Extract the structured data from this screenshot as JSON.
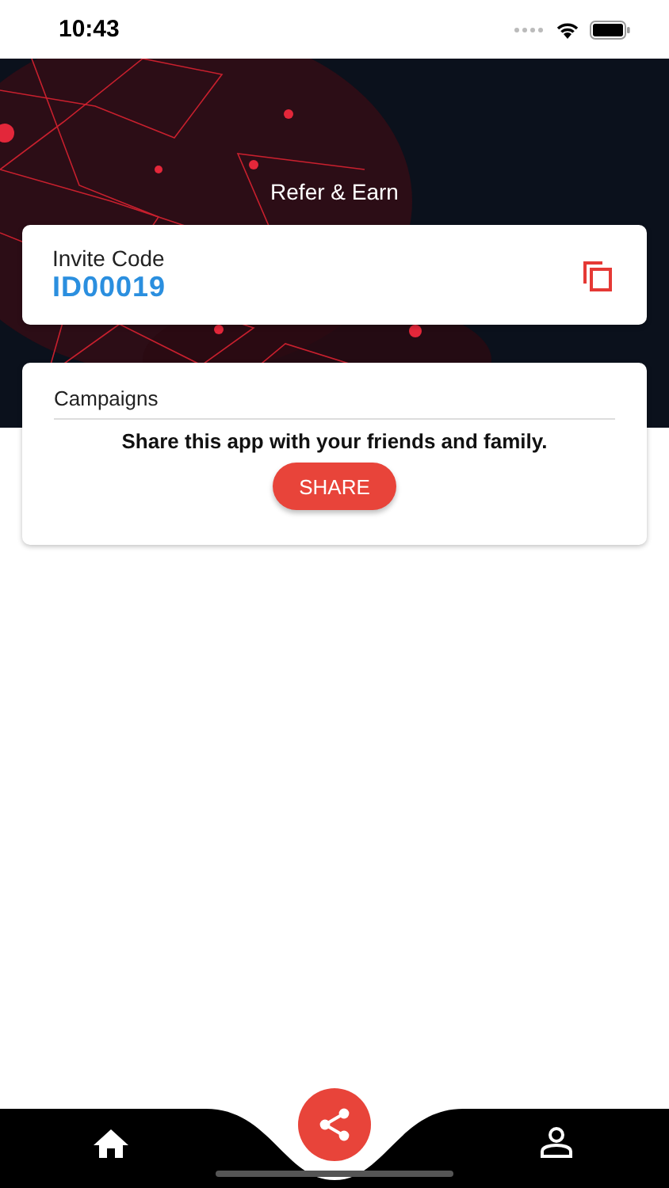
{
  "status_bar": {
    "time": "10:43"
  },
  "header": {
    "title": "Refer & Earn"
  },
  "invite": {
    "label": "Invite Code",
    "code": "ID00019"
  },
  "campaigns": {
    "title": "Campaigns",
    "message": "Share this app with your friends and family.",
    "button": "SHARE"
  }
}
